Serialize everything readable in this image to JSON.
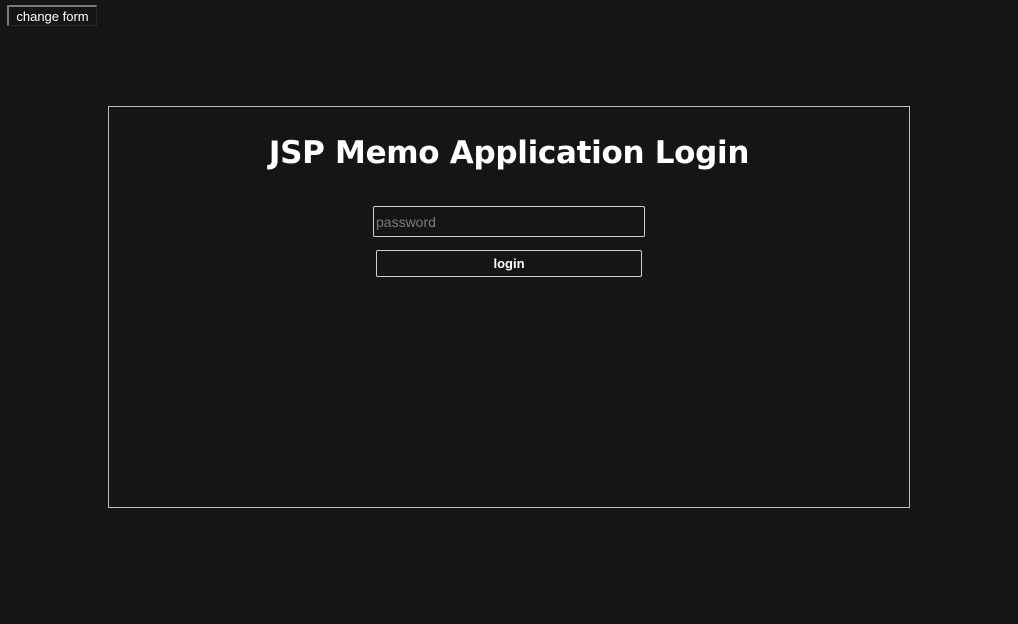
{
  "toolbar": {
    "change_form_label": "change form"
  },
  "login": {
    "title": "JSP Memo Application Login",
    "password_placeholder": "password",
    "password_value": "",
    "login_button_label": "login"
  },
  "colors": {
    "background": "#151515",
    "text": "#ffffff",
    "border": "#bdbdbd",
    "placeholder": "#7c7c7c"
  }
}
